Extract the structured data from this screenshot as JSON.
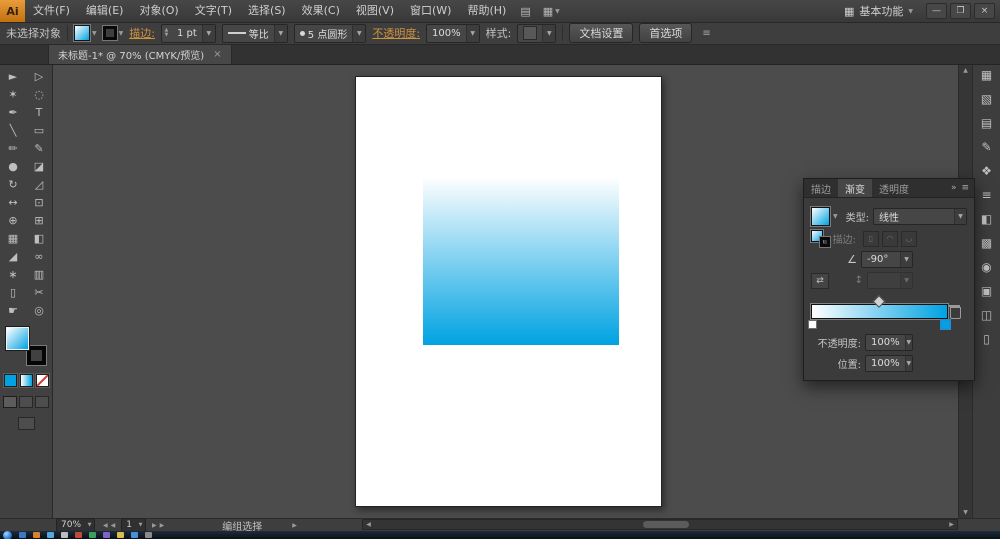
{
  "glyphs": {
    "dropdown": "▼",
    "up": "▲",
    "down": "▼",
    "left": "◀",
    "right": "▶",
    "double_left": "«",
    "double_right": "»",
    "menu": "≡",
    "grid": "▦",
    "doc": "▤"
  },
  "window": {
    "logo": "Ai",
    "workspace": "基本功能",
    "minimize_glyph": "—",
    "restore_glyph": "❐",
    "close_glyph": "×"
  },
  "menubar": {
    "menus": [
      {
        "name": "menu-file",
        "label": "文件(F)"
      },
      {
        "name": "menu-edit",
        "label": "编辑(E)"
      },
      {
        "name": "menu-object",
        "label": "对象(O)"
      },
      {
        "name": "menu-type",
        "label": "文字(T)"
      },
      {
        "name": "menu-select",
        "label": "选择(S)"
      },
      {
        "name": "menu-effect",
        "label": "效果(C)"
      },
      {
        "name": "menu-view",
        "label": "视图(V)"
      },
      {
        "name": "menu-window",
        "label": "窗口(W)"
      },
      {
        "name": "menu-help",
        "label": "帮助(H)"
      }
    ]
  },
  "controlbar": {
    "selection_status": "未选择对象",
    "stroke_link": "描边:",
    "stroke_width": "1 pt",
    "width_profile": "等比",
    "brush": "5 点圆形",
    "opacity_link": "不透明度:",
    "opacity_value": "100%",
    "style_label": "样式:",
    "document_setup": "文档设置",
    "preferences": "首选项"
  },
  "document_tab": {
    "title": "未标题-1* @ 70% (CMYK/预览)",
    "close_glyph": "×"
  },
  "tools": [
    {
      "name": "selection-tool",
      "glyph": "►"
    },
    {
      "name": "direct-selection-tool",
      "glyph": "▷"
    },
    {
      "name": "magic-wand-tool",
      "glyph": "✶"
    },
    {
      "name": "lasso-tool",
      "glyph": "◌"
    },
    {
      "name": "pen-tool",
      "glyph": "✒"
    },
    {
      "name": "type-tool",
      "glyph": "T"
    },
    {
      "name": "line-segment-tool",
      "glyph": "╲"
    },
    {
      "name": "rectangle-tool",
      "glyph": "▭"
    },
    {
      "name": "paintbrush-tool",
      "glyph": "✏"
    },
    {
      "name": "pencil-tool",
      "glyph": "✎"
    },
    {
      "name": "blob-brush-tool",
      "glyph": "●"
    },
    {
      "name": "eraser-tool",
      "glyph": "◪"
    },
    {
      "name": "rotate-tool",
      "glyph": "↻"
    },
    {
      "name": "scale-tool",
      "glyph": "◿"
    },
    {
      "name": "width-tool",
      "glyph": "↔"
    },
    {
      "name": "free-transform-tool",
      "glyph": "⊡"
    },
    {
      "name": "shape-builder-tool",
      "glyph": "⊕"
    },
    {
      "name": "perspective-grid-tool",
      "glyph": "⊞"
    },
    {
      "name": "mesh-tool",
      "glyph": "▦"
    },
    {
      "name": "gradient-tool",
      "glyph": "◧"
    },
    {
      "name": "eyedropper-tool",
      "glyph": "◢"
    },
    {
      "name": "blend-tool",
      "glyph": "∞"
    },
    {
      "name": "symbol-sprayer-tool",
      "glyph": "∗"
    },
    {
      "name": "column-graph-tool",
      "glyph": "▥"
    },
    {
      "name": "artboard-tool",
      "glyph": "▯"
    },
    {
      "name": "slice-tool",
      "glyph": "✂"
    },
    {
      "name": "hand-tool",
      "glyph": "☛"
    },
    {
      "name": "zoom-tool",
      "glyph": "◎"
    }
  ],
  "gradient": {
    "type": "线性",
    "angle": "-90°",
    "start_color": "#ffffff",
    "end_color": "#00a2e2",
    "midpoint_percent": 50,
    "stops": [
      {
        "color": "#ffffff",
        "position_percent": 0,
        "selected": false
      },
      {
        "color": "#00a2e2",
        "position_percent": 100,
        "selected": true
      }
    ],
    "opacity": "100%",
    "location": "100%"
  },
  "gradient_panel": {
    "tabs": [
      {
        "name": "tab-stroke",
        "label": "描边",
        "active": false
      },
      {
        "name": "tab-gradient",
        "label": "渐变",
        "active": true
      },
      {
        "name": "tab-transparency",
        "label": "透明度",
        "active": false
      }
    ],
    "type_label": "类型:",
    "stroke_label": "描边:",
    "angle_glyph": "∠",
    "reverse_glyph": "⇄",
    "aspect_glyph": "↕",
    "opacity_label": "不透明度:",
    "location_label": "位置:"
  },
  "dock": {
    "icons": [
      {
        "name": "color-panel-icon",
        "glyph": "▦"
      },
      {
        "name": "color-guide-panel-icon",
        "glyph": "▧"
      },
      {
        "name": "swatches-panel-icon",
        "glyph": "▤"
      },
      {
        "name": "brushes-panel-icon",
        "glyph": "✎"
      },
      {
        "name": "symbols-panel-icon",
        "glyph": "❖"
      },
      {
        "name": "stroke-panel-icon",
        "glyph": "≡"
      },
      {
        "name": "gradient-panel-icon",
        "glyph": "◧"
      },
      {
        "name": "transparency-panel-icon",
        "glyph": "▩"
      },
      {
        "name": "appearance-panel-icon",
        "glyph": "◉"
      },
      {
        "name": "graphic-styles-panel-icon",
        "glyph": "▣"
      },
      {
        "name": "layers-panel-icon",
        "glyph": "◫"
      },
      {
        "name": "artboards-panel-icon",
        "glyph": "▯"
      }
    ]
  },
  "statusbar": {
    "zoom": "70%",
    "artboard_number": "1",
    "tool_status": "编组选择"
  },
  "taskbar": {
    "icon_colors": [
      "#3a79c3",
      "#d5842c",
      "#56a8dc",
      "#bdbdbd",
      "#c14a39",
      "#3fa05e",
      "#8162c8",
      "#d8bf4d",
      "#4a8fd9",
      "#8a8a8a"
    ]
  }
}
